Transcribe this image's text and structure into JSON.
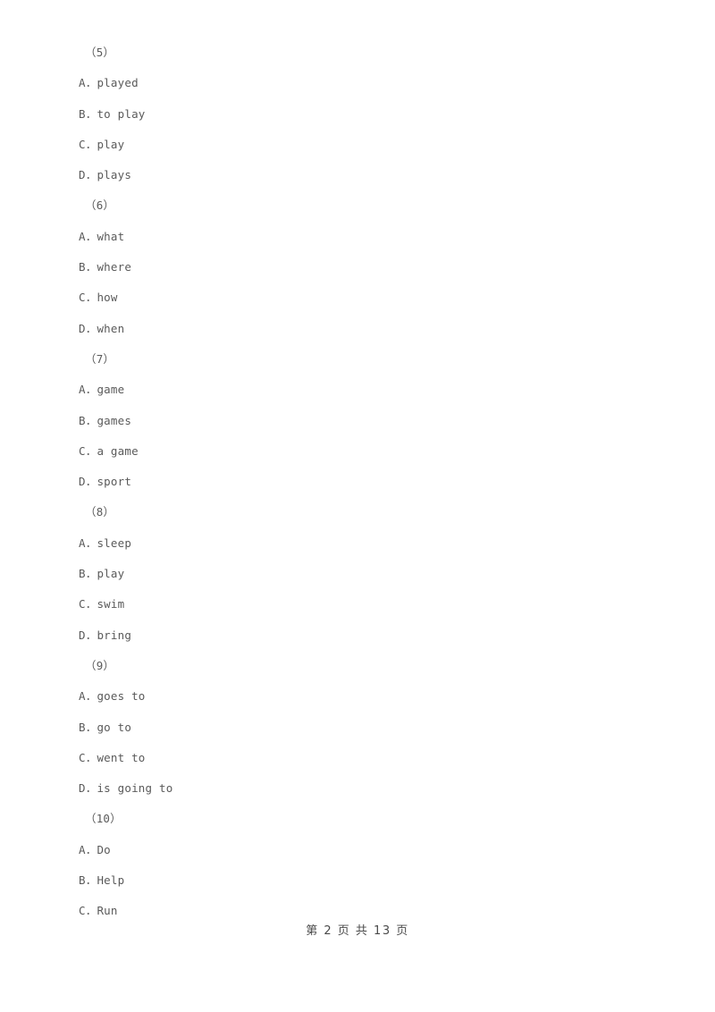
{
  "document": {
    "page_footer": "第 2 页 共 13 页"
  },
  "questions": [
    {
      "number": "（5）",
      "options": [
        {
          "letter": "A",
          "sep": "．",
          "text": "played"
        },
        {
          "letter": "B",
          "sep": "．",
          "text": "to play"
        },
        {
          "letter": "C",
          "sep": "．",
          "text": "play"
        },
        {
          "letter": "D",
          "sep": "．",
          "text": "plays"
        }
      ]
    },
    {
      "number": "（6）",
      "options": [
        {
          "letter": "A",
          "sep": "．",
          "text": "what"
        },
        {
          "letter": "B",
          "sep": "．",
          "text": "where"
        },
        {
          "letter": "C",
          "sep": "．",
          "text": "how"
        },
        {
          "letter": "D",
          "sep": "．",
          "text": "when"
        }
      ]
    },
    {
      "number": "（7）",
      "options": [
        {
          "letter": "A",
          "sep": "．",
          "text": "game"
        },
        {
          "letter": "B",
          "sep": "．",
          "text": "games"
        },
        {
          "letter": "C",
          "sep": "．",
          "text": "a game"
        },
        {
          "letter": "D",
          "sep": "．",
          "text": "sport"
        }
      ]
    },
    {
      "number": "（8）",
      "options": [
        {
          "letter": "A",
          "sep": "．",
          "text": "sleep"
        },
        {
          "letter": "B",
          "sep": "．",
          "text": "play"
        },
        {
          "letter": "C",
          "sep": "．",
          "text": "swim"
        },
        {
          "letter": "D",
          "sep": "．",
          "text": "bring"
        }
      ]
    },
    {
      "number": "（9）",
      "options": [
        {
          "letter": "A",
          "sep": "．",
          "text": "goes to"
        },
        {
          "letter": "B",
          "sep": "．",
          "text": "go to"
        },
        {
          "letter": "C",
          "sep": "．",
          "text": "went to"
        },
        {
          "letter": "D",
          "sep": "．",
          "text": "is going to"
        }
      ]
    },
    {
      "number": "（10）",
      "options": [
        {
          "letter": "A",
          "sep": "．",
          "text": "Do"
        },
        {
          "letter": "B",
          "sep": "．",
          "text": "Help"
        },
        {
          "letter": "C",
          "sep": "．",
          "text": "Run"
        }
      ]
    }
  ]
}
